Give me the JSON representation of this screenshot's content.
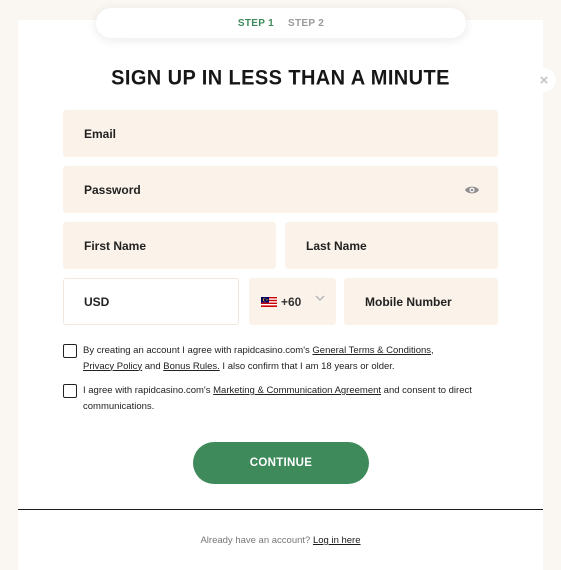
{
  "steps": {
    "step1": "STEP 1",
    "step2": "STEP 2"
  },
  "title": "SIGN UP IN LESS THAN A MINUTE",
  "close_glyph": "×",
  "fields": {
    "email": "Email",
    "password": "Password",
    "first_name": "First Name",
    "last_name": "Last Name",
    "currency": "USD",
    "phone_code": "+60",
    "mobile": "Mobile Number"
  },
  "icons": {
    "password_toggle": "eye-icon",
    "country_flag": "malaysia-flag-icon",
    "dropdown": "chevron-down-icon",
    "close": "close-icon"
  },
  "consent_terms": {
    "text_1": "By creating an account I agree with rapidcasino.com's ",
    "link_terms": "General Terms & Conditions",
    "text_2": ",",
    "link_privacy": "Privacy Policy",
    "text_3": " and ",
    "link_bonus": "Bonus Rules.",
    "text_4": " I also confirm that I am 18 years or older."
  },
  "consent_marketing": {
    "text_1": "I agree with rapidcasino.com's ",
    "link_agreement": "Marketing & Communication Agreement",
    "text_2": " and consent to direct communications."
  },
  "continue_label": "CONTINUE",
  "footer": {
    "prompt": "Already have an account?",
    "login_link": "Log in here"
  },
  "colors": {
    "accent": "#3e8a5b",
    "field_bg": "#fbf3ea",
    "page_bg": "#faf6f1"
  }
}
